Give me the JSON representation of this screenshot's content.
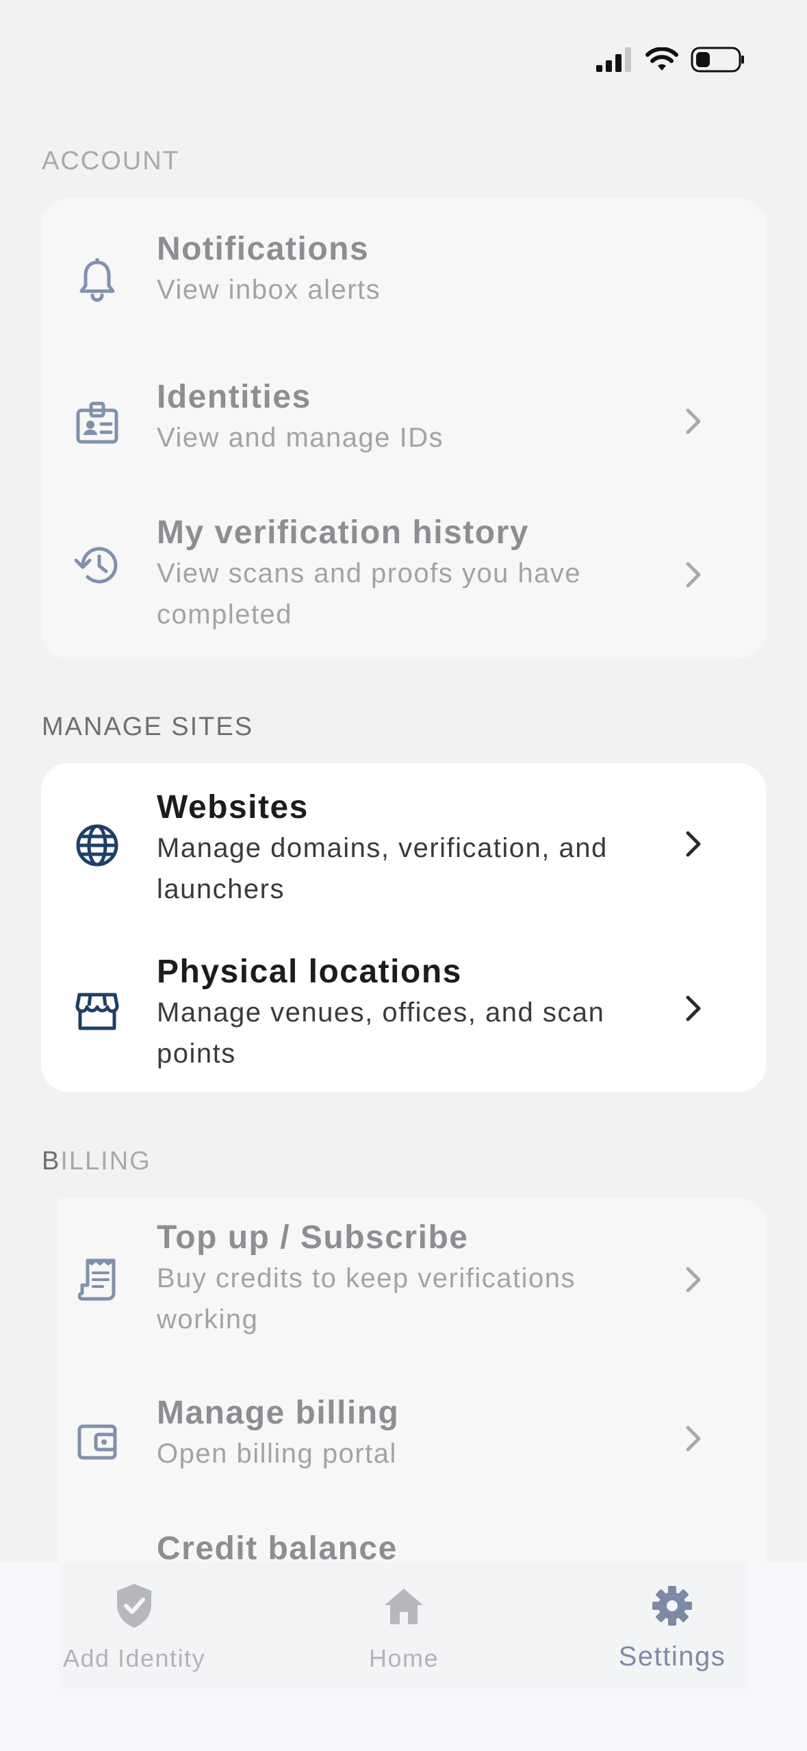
{
  "sections": {
    "account": "ACCOUNT",
    "manage_sites": "MANAGE SITES",
    "billing_first": "B",
    "billing_rest": "ILLING"
  },
  "account": {
    "notifications": {
      "title": "Notifications",
      "subtitle": "View inbox alerts"
    },
    "identities": {
      "title": "Identities",
      "subtitle": "View and manage IDs"
    },
    "history": {
      "title": "My verification history",
      "subtitle": "View scans and proofs you have completed"
    }
  },
  "manage_sites": {
    "websites": {
      "title": "Websites",
      "subtitle": "Manage domains, verification, and launchers"
    },
    "physical": {
      "title": "Physical locations",
      "subtitle": "Manage venues, offices, and scan points"
    }
  },
  "billing": {
    "topup": {
      "title": "Top up / Subscribe",
      "subtitle": "Buy credits to keep verifications working"
    },
    "manage": {
      "title": "Manage billing",
      "subtitle": "Open billing portal"
    },
    "credit": {
      "title": "Credit balance"
    }
  },
  "tabs": {
    "add_identity": "Add Identity",
    "home": "Home",
    "settings": "Settings"
  },
  "icons": {
    "notifications": "bell-icon",
    "identities": "id-badge-icon",
    "history": "history-icon",
    "websites": "globe-icon",
    "physical": "storefront-icon",
    "topup": "receipt-icon",
    "manage": "wallet-icon",
    "tab_add": "shield-check-icon",
    "tab_home": "home-icon",
    "tab_settings": "gear-icon"
  },
  "colors": {
    "active_icon": "#1f3f66",
    "muted_icon": "#8091ad",
    "settings_tab": "#7d8aa6"
  }
}
